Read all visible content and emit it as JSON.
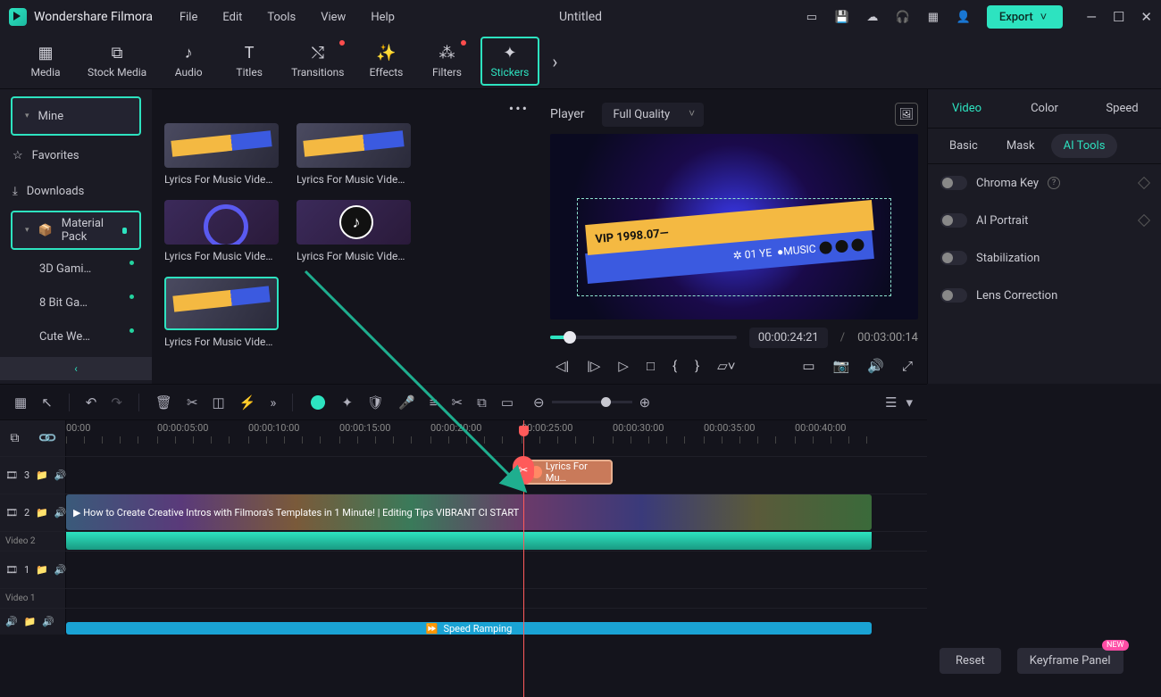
{
  "app": {
    "name": "Wondershare Filmora",
    "document": "Untitled"
  },
  "menu": [
    "File",
    "Edit",
    "Tools",
    "View",
    "Help"
  ],
  "export_label": "Export",
  "tabs": [
    {
      "label": "Media"
    },
    {
      "label": "Stock Media"
    },
    {
      "label": "Audio"
    },
    {
      "label": "Titles"
    },
    {
      "label": "Transitions",
      "dot": true
    },
    {
      "label": "Effects"
    },
    {
      "label": "Filters",
      "dot": true
    },
    {
      "label": "Stickers",
      "active": true
    }
  ],
  "sidebar": {
    "mine": "Mine",
    "favorites": "Favorites",
    "downloads": "Downloads",
    "material_pack": "Material Pack",
    "subs": [
      "3D Gami…",
      "8 Bit Ga…",
      "Cute We…"
    ]
  },
  "cards": [
    "Lyrics For Music Video…",
    "Lyrics For Music Video…",
    "Lyrics For Music Video…",
    "Lyrics For Music Video…",
    "Lyrics For Music Video…"
  ],
  "player": {
    "label": "Player",
    "quality": "Full Quality",
    "current": "00:00:24:21",
    "duration": "00:03:00:14",
    "banner1": "VIP 1998.07—",
    "banner2": "✲ 01 YE",
    "banner2b": "●MUSIC"
  },
  "prop_tabs": [
    "Video",
    "Color",
    "Speed"
  ],
  "prop_subtabs": [
    "Basic",
    "Mask",
    "AI Tools"
  ],
  "props": [
    {
      "label": "Chroma Key",
      "info": true,
      "diamond": true
    },
    {
      "label": "AI Portrait",
      "diamond": true
    },
    {
      "label": "Stabilization"
    },
    {
      "label": "Lens Correction"
    }
  ],
  "footer": {
    "reset": "Reset",
    "keyframe": "Keyframe Panel",
    "new": "NEW"
  },
  "ruler": [
    "00:00",
    "00:00:05:00",
    "00:00:10:00",
    "00:00:15:00",
    "00:00:20:00",
    "00:00:25:00",
    "00:00:30:00",
    "00:00:35:00",
    "00:00:40:00"
  ],
  "tracks": {
    "t3": "3",
    "t2": "2",
    "t2label": "Video 2",
    "t1": "1",
    "t1label": "Video 1",
    "sticker_clip": "Lyrics For Mu…",
    "video_clip": "How to Create Creative Intros with Filmora's Templates in 1 Minute! | Editing Tips   VIBRANT CI       START",
    "speed": "Speed Ramping"
  }
}
